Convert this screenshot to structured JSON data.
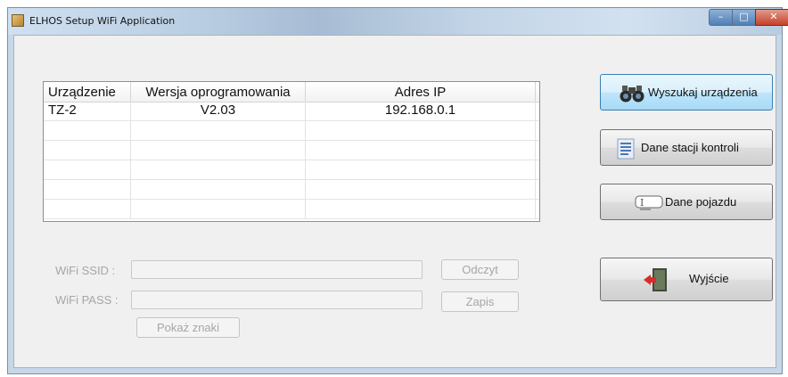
{
  "window": {
    "title": "ELHOS Setup WiFi Application",
    "controls": {
      "minimize": "–",
      "maximize": "□",
      "close": "✕"
    }
  },
  "device_table": {
    "columns": [
      "Urządzenie",
      "Wersja oprogramowania",
      "Adres IP"
    ],
    "rows": [
      {
        "device": "TZ-2",
        "version": "V2.03",
        "ip": "192.168.0.1"
      }
    ]
  },
  "wifi": {
    "ssid_label": "WiFi SSID :",
    "ssid_value": "",
    "pass_label": "WiFi PASS :",
    "pass_value": "",
    "read_button": "Odczyt",
    "write_button": "Zapis",
    "show_chars_button": "Pokaż znaki",
    "enabled": false
  },
  "actions": {
    "search": "Wyszukaj urządzenia",
    "station_data": "Dane stacji kontroli",
    "vehicle_data": "Dane pojazdu",
    "exit": "Wyjście"
  },
  "icons": {
    "search": "binoculars-icon",
    "station_data": "document-list-icon",
    "vehicle_data": "id-card-icon",
    "exit": "exit-door-icon"
  }
}
